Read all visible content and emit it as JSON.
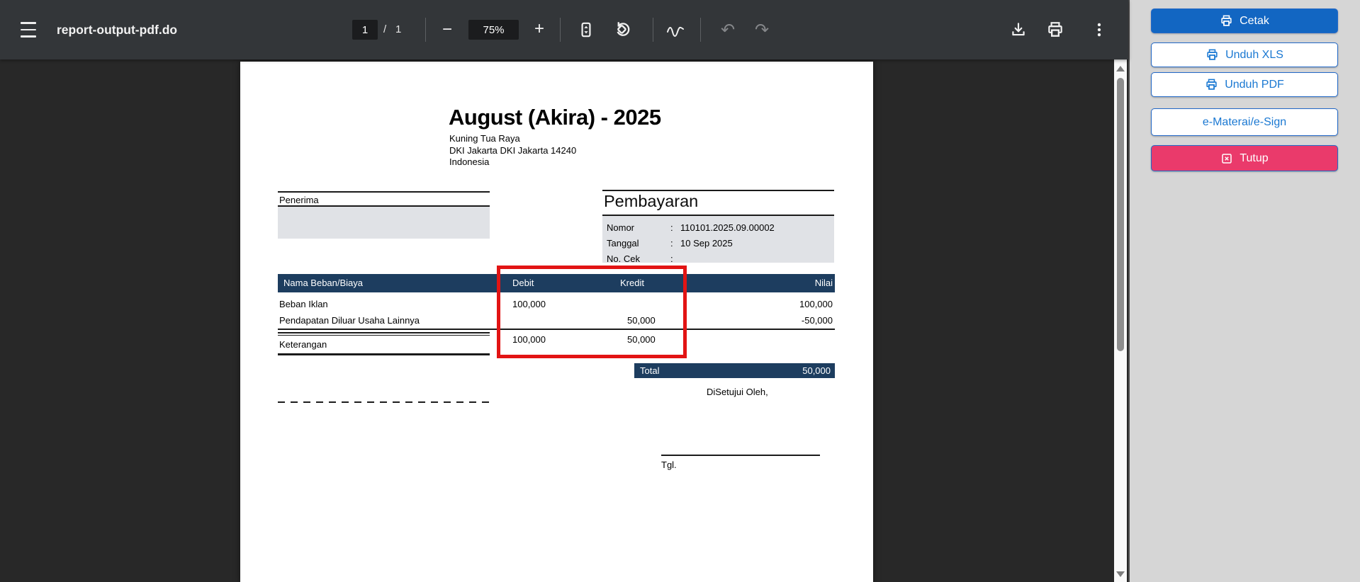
{
  "toolbar": {
    "title": "report-output-pdf.do",
    "page_current": "1",
    "page_separator": "/",
    "page_total": "1",
    "zoom_level": "75%",
    "minus": "−",
    "plus": "+",
    "undo": "↶",
    "redo": "↷"
  },
  "document": {
    "title": "August (Akira) - 2025",
    "address_line1": "Kuning Tua Raya",
    "address_line2": "DKI Jakarta DKI Jakarta 14240",
    "address_line3": "Indonesia",
    "penerima_label": "Penerima",
    "pembayaran": {
      "heading": "Pembayaran",
      "rows": [
        {
          "label": "Nomor",
          "colon": ":",
          "value": "110101.2025.09.00002"
        },
        {
          "label": "Tanggal",
          "colon": ":",
          "value": "10 Sep 2025"
        },
        {
          "label": "No. Cek",
          "colon": ":",
          "value": ""
        }
      ]
    },
    "table": {
      "headers": {
        "name": "Nama Beban/Biaya",
        "debit": "Debit",
        "kredit": "Kredit",
        "nilai": "Nilai"
      },
      "rows": [
        {
          "name": "Beban Iklan",
          "debit": "100,000",
          "kredit": "",
          "nilai": "100,000"
        },
        {
          "name": "Pendapatan Diluar Usaha Lainnya",
          "debit": "",
          "kredit": "50,000",
          "nilai": "-50,000"
        }
      ],
      "totals": {
        "debit": "100,000",
        "kredit": "50,000"
      },
      "keterangan_label": "Keterangan",
      "total_label": "Total",
      "total_value": "50,000"
    },
    "approval": {
      "disetujui": "DiSetujui Oleh,",
      "tgl": "Tgl."
    }
  },
  "sidebar": {
    "print_label": "Cetak",
    "download_xls_label": "Unduh XLS",
    "download_pdf_label": "Unduh PDF",
    "esign_label": "e-Materai/e-Sign",
    "close_label": "Tutup"
  },
  "colors": {
    "table_header_navy": "#1d3d5f",
    "highlight_red": "#e21414",
    "primary_blue": "#1266c2",
    "link_blue": "#1a78d2",
    "close_pink": "#ea3a6b",
    "toolbar_gray": "#333639",
    "canvas_gray": "#282828",
    "sidebar_gray": "#d6d6d6"
  }
}
